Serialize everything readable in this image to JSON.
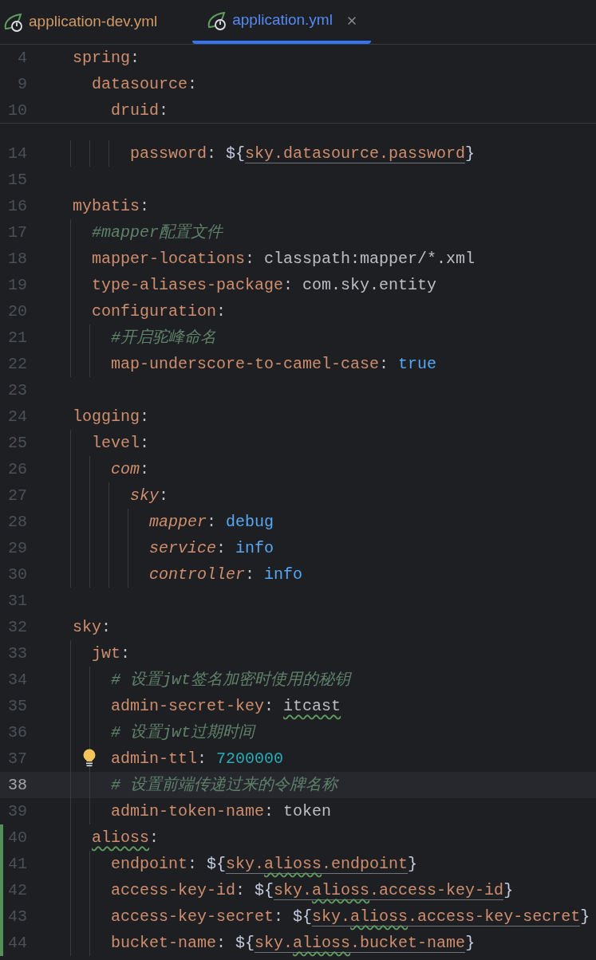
{
  "tabs": [
    {
      "label": "application-dev.yml",
      "selected": false
    },
    {
      "label": "application.yml",
      "selected": true
    }
  ],
  "sticky_lines": [
    {
      "number": "4",
      "tokens": [
        {
          "text": "spring",
          "kind": "key"
        },
        {
          "text": ":",
          "kind": "punct"
        }
      ]
    },
    {
      "number": "9",
      "tokens": [
        {
          "text": "datasource",
          "kind": "key"
        },
        {
          "text": ":",
          "kind": "punct"
        }
      ]
    },
    {
      "number": "10",
      "tokens": [
        {
          "text": "druid",
          "kind": "key"
        },
        {
          "text": ":",
          "kind": "punct"
        }
      ]
    }
  ],
  "lines": [
    {
      "children": [
        {
          "children": [
            {
              "children": [
                {
                  "number": "14",
                  "current": false,
                  "hint": false,
                  "changed": false,
                  "tokens": [
                    {
                      "text": "password",
                      "kind": "key"
                    },
                    {
                      "text": ": ",
                      "kind": "punct"
                    },
                    {
                      "text": "${",
                      "kind": "brace"
                    },
                    {
                      "text": "sky.datasource.password",
                      "kind": "ref"
                    },
                    {
                      "text": "}",
                      "kind": "brace"
                    }
                  ]
                }
              ]
            }
          ]
        }
      ]
    },
    {
      "number": "15",
      "current": false,
      "hint": false,
      "changed": false
    },
    {
      "number": "16",
      "current": false,
      "hint": false,
      "changed": false,
      "tokens": [
        {
          "text": "mybatis",
          "kind": "key"
        },
        {
          "text": ":",
          "kind": "punct"
        }
      ],
      "children": [
        {
          "number": "17",
          "current": false,
          "hint": false,
          "changed": false,
          "tokens": [
            {
              "text": "#mapper配置文件",
              "kind": "comment"
            }
          ]
        },
        {
          "number": "18",
          "current": false,
          "hint": false,
          "changed": false,
          "tokens": [
            {
              "text": "mapper-locations",
              "kind": "key"
            },
            {
              "text": ": ",
              "kind": "punct"
            },
            {
              "text": "classpath:mapper/*.xml",
              "kind": "plain"
            }
          ]
        },
        {
          "number": "19",
          "current": false,
          "hint": false,
          "changed": false,
          "tokens": [
            {
              "text": "type-aliases-package",
              "kind": "key"
            },
            {
              "text": ": ",
              "kind": "punct"
            },
            {
              "text": "com.sky.entity",
              "kind": "plain"
            }
          ]
        },
        {
          "number": "20",
          "current": false,
          "hint": false,
          "changed": false,
          "tokens": [
            {
              "text": "configuration",
              "kind": "key"
            },
            {
              "text": ":",
              "kind": "punct"
            }
          ],
          "children": [
            {
              "number": "21",
              "current": false,
              "hint": false,
              "changed": false,
              "tokens": [
                {
                  "text": "#开启驼峰命名",
                  "kind": "comment"
                }
              ]
            },
            {
              "number": "22",
              "current": false,
              "hint": false,
              "changed": false,
              "tokens": [
                {
                  "text": "map-underscore-to-camel-case",
                  "kind": "key"
                },
                {
                  "text": ": ",
                  "kind": "punct"
                },
                {
                  "text": "true",
                  "kind": "keyword"
                }
              ]
            }
          ]
        }
      ]
    },
    {
      "number": "23",
      "current": false,
      "hint": false,
      "changed": false
    },
    {
      "number": "24",
      "current": false,
      "hint": false,
      "changed": false,
      "tokens": [
        {
          "text": "logging",
          "kind": "key"
        },
        {
          "text": ":",
          "kind": "punct"
        }
      ],
      "children": [
        {
          "number": "25",
          "current": false,
          "hint": false,
          "changed": false,
          "tokens": [
            {
              "text": "level",
              "kind": "key"
            },
            {
              "text": ":",
              "kind": "punct"
            }
          ],
          "children": [
            {
              "number": "26",
              "current": false,
              "hint": false,
              "changed": false,
              "tokens": [
                {
                  "text": "com",
                  "kind": "ikey"
                },
                {
                  "text": ":",
                  "kind": "punct"
                }
              ],
              "children": [
                {
                  "number": "27",
                  "current": false,
                  "hint": false,
                  "changed": false,
                  "tokens": [
                    {
                      "text": "sky",
                      "kind": "ikey"
                    },
                    {
                      "text": ":",
                      "kind": "punct"
                    }
                  ],
                  "children": [
                    {
                      "number": "28",
                      "current": false,
                      "hint": false,
                      "changed": false,
                      "tokens": [
                        {
                          "text": "mapper",
                          "kind": "ikey"
                        },
                        {
                          "text": ": ",
                          "kind": "punct"
                        },
                        {
                          "text": "debug",
                          "kind": "keyword"
                        }
                      ]
                    },
                    {
                      "number": "29",
                      "current": false,
                      "hint": false,
                      "changed": false,
                      "tokens": [
                        {
                          "text": "service",
                          "kind": "ikey"
                        },
                        {
                          "text": ": ",
                          "kind": "punct"
                        },
                        {
                          "text": "info",
                          "kind": "keyword"
                        }
                      ]
                    },
                    {
                      "number": "30",
                      "current": false,
                      "hint": false,
                      "changed": false,
                      "tokens": [
                        {
                          "text": "controller",
                          "kind": "ikey"
                        },
                        {
                          "text": ": ",
                          "kind": "punct"
                        },
                        {
                          "text": "info",
                          "kind": "keyword"
                        }
                      ]
                    }
                  ]
                }
              ]
            }
          ]
        }
      ]
    },
    {
      "number": "31",
      "current": false,
      "hint": false,
      "changed": false
    },
    {
      "number": "32",
      "current": false,
      "hint": false,
      "changed": false,
      "tokens": [
        {
          "text": "sky",
          "kind": "key"
        },
        {
          "text": ":",
          "kind": "punct"
        }
      ],
      "children": [
        {
          "number": "33",
          "current": false,
          "hint": false,
          "changed": false,
          "tokens": [
            {
              "text": "jwt",
              "kind": "key"
            },
            {
              "text": ":",
              "kind": "punct"
            }
          ],
          "children": [
            {
              "number": "34",
              "current": false,
              "hint": false,
              "changed": false,
              "tokens": [
                {
                  "text": "# 设置jwt签名加密时使用的秘钥",
                  "kind": "comment"
                }
              ]
            },
            {
              "number": "35",
              "current": false,
              "hint": false,
              "changed": false,
              "tokens": [
                {
                  "text": "admin-secret-key",
                  "kind": "key"
                },
                {
                  "text": ": ",
                  "kind": "punct"
                },
                {
                  "text": "itcast",
                  "kind": "plain-typo"
                }
              ]
            },
            {
              "number": "36",
              "current": false,
              "hint": false,
              "changed": false,
              "tokens": [
                {
                  "text": "# 设置jwt过期时间",
                  "kind": "comment"
                }
              ]
            },
            {
              "number": "37",
              "current": false,
              "hint": true,
              "changed": false,
              "tokens": [
                {
                  "text": "admin-ttl",
                  "kind": "key"
                },
                {
                  "text": ": ",
                  "kind": "punct"
                },
                {
                  "text": "7200000",
                  "kind": "number"
                }
              ]
            },
            {
              "number": "38",
              "current": true,
              "hint": false,
              "changed": false,
              "tokens": [
                {
                  "text": "# 设置前端传递过来的令牌名称",
                  "kind": "comment"
                }
              ]
            },
            {
              "number": "39",
              "current": false,
              "hint": false,
              "changed": false,
              "tokens": [
                {
                  "text": "admin-token-name",
                  "kind": "key"
                },
                {
                  "text": ": ",
                  "kind": "punct"
                },
                {
                  "text": "token",
                  "kind": "plain"
                }
              ]
            }
          ]
        },
        {
          "number": "40",
          "current": false,
          "hint": false,
          "changed": true,
          "tokens": [
            {
              "text": "alioss",
              "kind": "key-typo"
            },
            {
              "text": ":",
              "kind": "punct"
            }
          ],
          "children": [
            {
              "number": "41",
              "current": false,
              "hint": false,
              "changed": true,
              "tokens": [
                {
                  "text": "endpoint",
                  "kind": "key"
                },
                {
                  "text": ": ",
                  "kind": "punct"
                },
                {
                  "text": "${",
                  "kind": "brace"
                },
                {
                  "text": "sky.",
                  "kind": "ref"
                },
                {
                  "text": "alioss",
                  "kind": "ref-typo"
                },
                {
                  "text": ".endpoint",
                  "kind": "ref"
                },
                {
                  "text": "}",
                  "kind": "brace"
                }
              ]
            },
            {
              "number": "42",
              "current": false,
              "hint": false,
              "changed": true,
              "tokens": [
                {
                  "text": "access-key-id",
                  "kind": "key"
                },
                {
                  "text": ": ",
                  "kind": "punct"
                },
                {
                  "text": "${",
                  "kind": "brace"
                },
                {
                  "text": "sky.",
                  "kind": "ref"
                },
                {
                  "text": "alioss",
                  "kind": "ref-typo"
                },
                {
                  "text": ".access-key-id",
                  "kind": "ref"
                },
                {
                  "text": "}",
                  "kind": "brace"
                }
              ]
            },
            {
              "number": "43",
              "current": false,
              "hint": false,
              "changed": true,
              "tokens": [
                {
                  "text": "access-key-secret",
                  "kind": "key"
                },
                {
                  "text": ": ",
                  "kind": "punct"
                },
                {
                  "text": "${",
                  "kind": "brace"
                },
                {
                  "text": "sky.",
                  "kind": "ref"
                },
                {
                  "text": "alioss",
                  "kind": "ref-typo"
                },
                {
                  "text": ".access-key-secret",
                  "kind": "ref"
                },
                {
                  "text": "}",
                  "kind": "brace"
                }
              ]
            },
            {
              "number": "44",
              "current": false,
              "hint": false,
              "changed": true,
              "tokens": [
                {
                  "text": "bucket-name",
                  "kind": "key"
                },
                {
                  "text": ": ",
                  "kind": "punct"
                },
                {
                  "text": "${",
                  "kind": "brace"
                },
                {
                  "text": "sky.",
                  "kind": "ref"
                },
                {
                  "text": "alioss",
                  "kind": "ref-typo"
                },
                {
                  "text": ".bucket-name",
                  "kind": "ref"
                },
                {
                  "text": "}",
                  "kind": "brace"
                }
              ]
            }
          ]
        }
      ]
    }
  ]
}
